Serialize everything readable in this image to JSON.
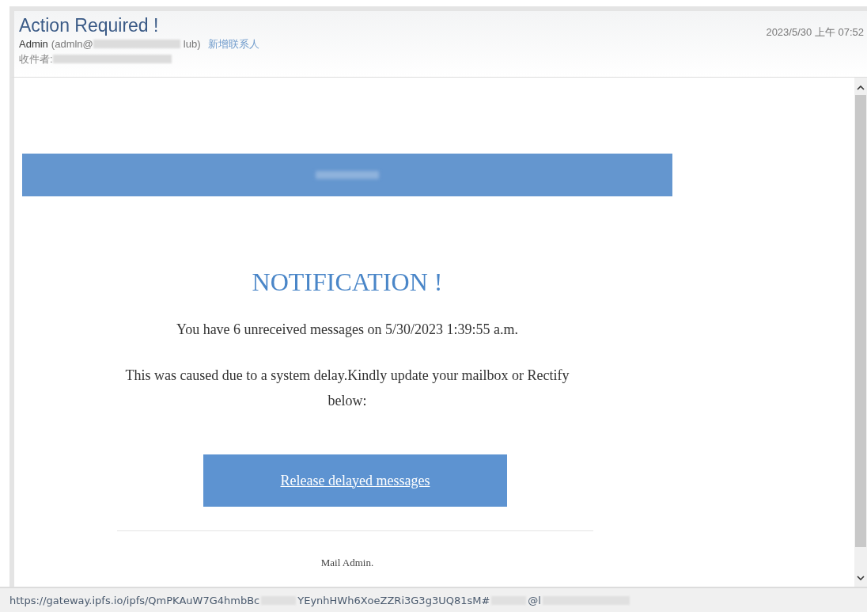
{
  "email": {
    "subject": "Action Required !",
    "sender_name": "Admin",
    "sender_address_start": "(admln@",
    "sender_address_end": "lub)",
    "add_contact": "新增联系人",
    "recipient_label": "收件者:",
    "date": "2023/5/30 上午 07:52"
  },
  "message": {
    "title": "NOTIFICATION !",
    "line_1": "You have 6 unreceived messages on 5/30/2023 1:39:55 a.m.",
    "line_2": "This was caused due to a system delay.Kindly update your mailbox or Rectify below:",
    "button": "Release delayed messages",
    "signature": "Mail Admin."
  },
  "status_bar": {
    "url_parts": [
      "https://gateway.ipfs.io/ipfs/QmPKAuW7G4hmbBc",
      "YEynhHWh6XoeZZRi3G3g3UQ81sM#",
      "@l"
    ]
  }
}
